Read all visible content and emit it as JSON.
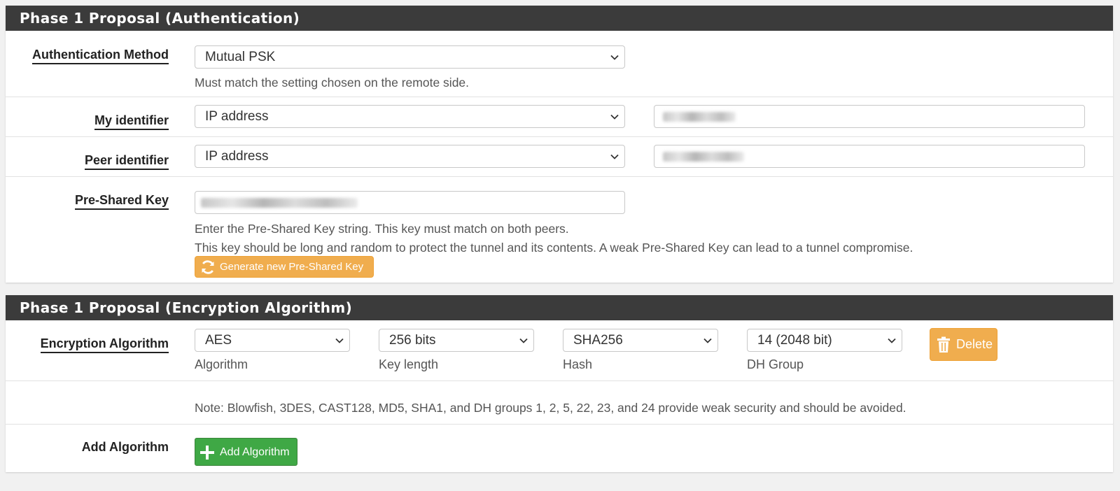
{
  "auth_section": {
    "title": "Phase 1 Proposal (Authentication)",
    "auth_method": {
      "label": "Authentication Method",
      "value": "Mutual PSK",
      "help": "Must match the setting chosen on the remote side."
    },
    "my_identifier": {
      "label": "My identifier",
      "type_value": "IP address"
    },
    "peer_identifier": {
      "label": "Peer identifier",
      "type_value": "IP address"
    },
    "psk": {
      "label": "Pre-Shared Key",
      "help_line1": "Enter the Pre-Shared Key string. This key must match on both peers.",
      "help_line2": "This key should be long and random to protect the tunnel and its contents. A weak Pre-Shared Key can lead to a tunnel compromise.",
      "generate_label": "Generate new Pre-Shared Key"
    }
  },
  "encryption_section": {
    "title": "Phase 1 Proposal (Encryption Algorithm)",
    "label": "Encryption Algorithm",
    "algorithm": {
      "value": "AES",
      "caption": "Algorithm"
    },
    "key_length": {
      "value": "256 bits",
      "caption": "Key length"
    },
    "hash": {
      "value": "SHA256",
      "caption": "Hash"
    },
    "dh_group": {
      "value": "14 (2048 bit)",
      "caption": "DH Group"
    },
    "delete_label": "Delete",
    "note": "Note: Blowfish, 3DES, CAST128, MD5, SHA1, and DH groups 1, 2, 5, 22, 23, and 24 provide weak security and should be avoided.",
    "add_label": "Add Algorithm",
    "add_button_label": "Add Algorithm"
  },
  "colors": {
    "heading_bg": "#3b3b3b",
    "warning": "#f0ad4e",
    "success": "#3fa845"
  },
  "icons": {
    "select": "chevron-down-icon",
    "generate": "refresh-icon",
    "delete": "trash-icon",
    "add": "plus-icon"
  }
}
